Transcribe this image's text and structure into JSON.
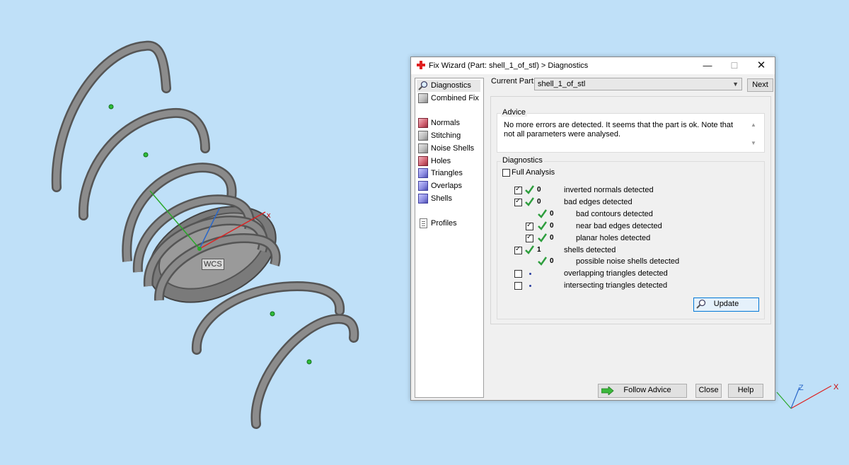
{
  "viewport": {
    "wcs_label": "WCS",
    "x_axis_label": "x",
    "corner_z_label": "Z",
    "corner_x_label": "X"
  },
  "window": {
    "title": "Fix Wizard (Part: shell_1_of_stl) > Diagnostics",
    "minimize_glyph": "—",
    "maximize_glyph": "☐",
    "close_glyph": "✕"
  },
  "nav": {
    "items": [
      {
        "label": "Diagnostics",
        "icon": "magnifier-icon"
      },
      {
        "label": "Combined Fix",
        "icon": "cube-icon"
      },
      {
        "label": "Normals",
        "icon": "cube-icon"
      },
      {
        "label": "Stitching",
        "icon": "cube-icon"
      },
      {
        "label": "Noise Shells",
        "icon": "cube-icon"
      },
      {
        "label": "Holes",
        "icon": "cube-icon"
      },
      {
        "label": "Triangles",
        "icon": "cube-icon"
      },
      {
        "label": "Overlaps",
        "icon": "cube-icon"
      },
      {
        "label": "Shells",
        "icon": "cube-icon"
      },
      {
        "label": "Profiles",
        "icon": "profile-icon"
      }
    ]
  },
  "current_part": {
    "label": "Current Part:",
    "value": "shell_1_of_stl",
    "next_label": "Next"
  },
  "advice": {
    "title": "Advice",
    "text": "No more errors are detected. It seems that the part is ok. Note that not all parameters were analysed."
  },
  "diagnostics": {
    "title": "Diagnostics",
    "full_analysis_label": "Full Analysis",
    "full_analysis_checked": false,
    "rows": [
      {
        "checkbox": true,
        "checked": true,
        "status": "ok",
        "count": "0",
        "label": "inverted normals detected",
        "indent": 0
      },
      {
        "checkbox": true,
        "checked": true,
        "status": "ok",
        "count": "0",
        "label": "bad edges detected",
        "indent": 0
      },
      {
        "checkbox": false,
        "checked": false,
        "status": "ok",
        "count": "0",
        "label": "bad contours detected",
        "indent": 1
      },
      {
        "checkbox": true,
        "checked": true,
        "status": "ok",
        "count": "0",
        "label": "near bad edges detected",
        "indent": 1
      },
      {
        "checkbox": true,
        "checked": true,
        "status": "ok",
        "count": "0",
        "label": "planar holes detected",
        "indent": 1
      },
      {
        "checkbox": true,
        "checked": true,
        "status": "ok",
        "count": "1",
        "label": "shells detected",
        "indent": 0
      },
      {
        "checkbox": false,
        "checked": false,
        "status": "ok",
        "count": "0",
        "label": "possible noise shells detected",
        "indent": 1
      },
      {
        "checkbox": true,
        "checked": false,
        "status": "pending",
        "count": "",
        "label": "overlapping triangles detected",
        "indent": 0
      },
      {
        "checkbox": true,
        "checked": false,
        "status": "pending",
        "count": "",
        "label": "intersecting triangles detected",
        "indent": 0
      }
    ],
    "update_label": "Update"
  },
  "footer": {
    "follow_advice_label": "Follow Advice",
    "close_label": "Close",
    "help_label": "Help"
  },
  "colors": {
    "viewport_bg": "#bfe0f8",
    "tick_green": "#2e9e3e",
    "title_icon_red": "#e02020"
  }
}
